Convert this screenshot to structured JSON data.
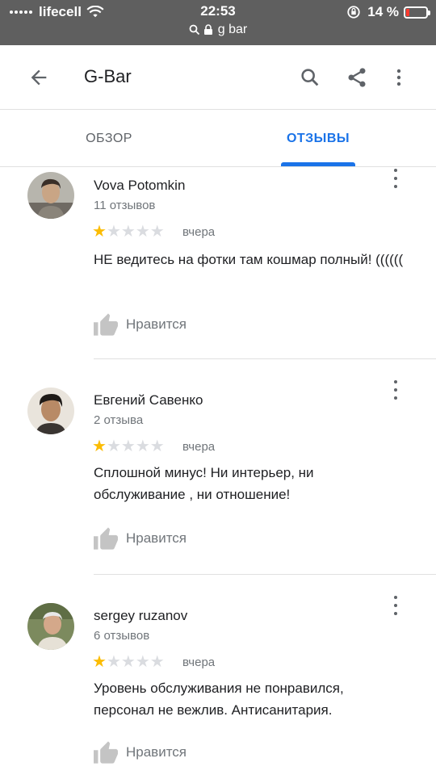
{
  "status_bar": {
    "carrier": "lifecell",
    "time": "22:53",
    "battery": "14 %",
    "url": "g bar"
  },
  "header": {
    "title": "G-Bar",
    "icons": [
      "back-arrow-icon",
      "search-icon",
      "share-icon",
      "more-vert-icon"
    ]
  },
  "tabs": [
    {
      "label": "ОБЗОР",
      "active": false
    },
    {
      "label": "ОТЗЫВЫ",
      "active": true
    }
  ],
  "colors": {
    "accent": "#1a73e8",
    "star": "#fbbc04",
    "status_bar": "#5f5f5f"
  },
  "reviews": [
    {
      "author": "Vova Potomkin",
      "count": "11 отзывов",
      "rating": 1,
      "date": "вчера",
      "text": "НЕ ведитесь на фотки там кошмар полный! ((((((",
      "like_label": "Нравится"
    },
    {
      "author": "Евгений Савенко",
      "count": "2 отзыва",
      "rating": 1,
      "date": "вчера",
      "text": "Сплошной минус! Ни интерьер, ни обслуживание , ни отношение!",
      "like_label": "Нравится"
    },
    {
      "author": "sergey ruzanov",
      "count": "6 отзывов",
      "rating": 1,
      "date": "вчера",
      "text": "Уровень обслуживания не понравился, персонал не вежлив. Антисанитария.",
      "like_label": "Нравится"
    }
  ]
}
